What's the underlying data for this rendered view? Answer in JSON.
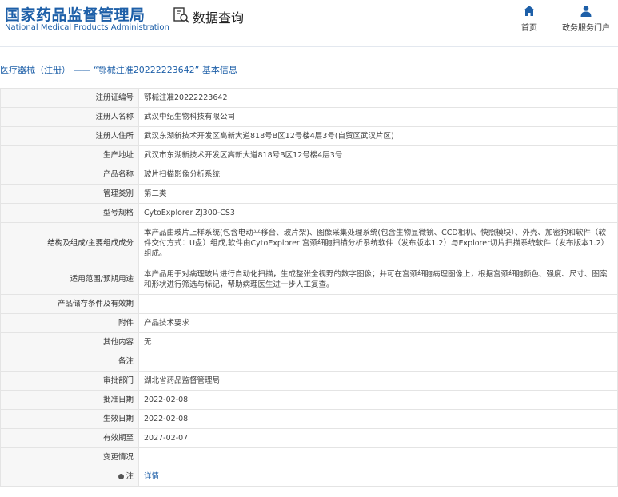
{
  "header": {
    "logo_cn": "国家药品监督管理局",
    "logo_en": "National Medical Products Administration",
    "query_label": "数据查询",
    "nav": {
      "home": "首页",
      "portal": "政务服务门户"
    }
  },
  "breadcrumb": {
    "prefix": "医疗器械（注册）",
    "separator": " —— ",
    "title": "“鄂械注准20222223642” 基本信息"
  },
  "fields": {
    "reg_no": {
      "label": "注册证编号",
      "value": "鄂械注准20222223642"
    },
    "registrant": {
      "label": "注册人名称",
      "value": "武汉中纪生物科技有限公司"
    },
    "registrant_address": {
      "label": "注册人住所",
      "value": "武汉东湖新技术开发区高新大道818号B区12号楼4层3号(自贸区武汉片区)"
    },
    "production_address": {
      "label": "生产地址",
      "value": "武汉市东湖新技术开发区高新大道818号B区12号楼4层3号"
    },
    "product_name": {
      "label": "产品名称",
      "value": "玻片扫描影像分析系统"
    },
    "management_class": {
      "label": "管理类别",
      "value": "第二类"
    },
    "model_spec": {
      "label": "型号规格",
      "value": "CytoExplorer ZJ300-CS3"
    },
    "structure": {
      "label": "结构及组成/主要组成成分",
      "value": "本产品由玻片上样系统(包含电动平移台、玻片架)、图像采集处理系统(包含生物显微镜、CCD相机、快照模块）、外壳、加密狗和软件（软件交付方式：U盘）组成,软件由CytoExplorer 宫颈细胞扫描分析系统软件（发布版本1.2）与Explorer切片扫描系统软件（发布版本1.2）组成。"
    },
    "scope": {
      "label": "适用范围/预期用途",
      "value": "本产品用于对病理玻片进行自动化扫描，生成整张全视野的数字图像；并可在宫颈细胞病理图像上，根据宫颈细胞颜色、强度、尺寸、图案和形状进行筛选与标记，帮助病理医生进一步人工复查。"
    },
    "storage": {
      "label": "产品储存条件及有效期",
      "value": ""
    },
    "attachment": {
      "label": "附件",
      "value": "产品技术要求"
    },
    "other": {
      "label": "其他内容",
      "value": "无"
    },
    "remark": {
      "label": "备注",
      "value": ""
    },
    "approval_dept": {
      "label": "审批部门",
      "value": "湖北省药品监督管理局"
    },
    "approval_date": {
      "label": "批准日期",
      "value": "2022-02-08"
    },
    "effective_date": {
      "label": "生效日期",
      "value": "2022-02-08"
    },
    "valid_until": {
      "label": "有效期至",
      "value": "2027-02-07"
    },
    "changes": {
      "label": "变更情况",
      "value": ""
    },
    "note": {
      "label": "注",
      "value": "详情"
    }
  },
  "colors": {
    "brand_blue": "#1d5fa8",
    "label_bg": "#f7f7f7",
    "border": "#e4e4e4"
  }
}
